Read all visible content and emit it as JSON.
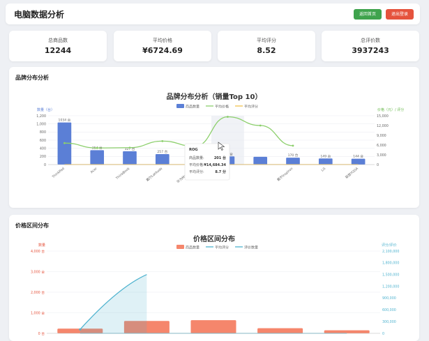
{
  "header": {
    "title": "电脑数据分析",
    "back_label": "返回首页",
    "logout_label": "退出登录"
  },
  "stats": [
    {
      "label": "总商品数",
      "value": "12244"
    },
    {
      "label": "平均价格",
      "value": "¥6724.69"
    },
    {
      "label": "平均评分",
      "value": "8.52"
    },
    {
      "label": "总评价数",
      "value": "3937243"
    }
  ],
  "brand_section": {
    "title": "品牌分布分析"
  },
  "price_section": {
    "title": "价格区间分布"
  },
  "colors": {
    "bar_blue": "#5b7fd6",
    "line_green": "#8ccf6c",
    "line_yellow": "#f2c14e",
    "bar_salmon": "#f5866c",
    "line_cyan": "#4fb3cf",
    "green_btn": "#3fa34d",
    "red_btn": "#e5533d"
  },
  "chart_data": [
    {
      "type": "bar",
      "title": "品牌分布分析（销量Top 10）",
      "categories": [
        "ThinkPad",
        "Acer",
        "ThinkBook",
        "戴尔Latitude",
        "华为MateBook",
        "ROG",
        "",
        "戴尔Inspiron",
        "LG",
        "联想YOGA"
      ],
      "bar_labels": [
        "1034 台",
        "354 台",
        "327 台",
        "257 台",
        "205 台",
        "201 台",
        "",
        "170 台",
        "149 台",
        "144 台"
      ],
      "series": [
        {
          "name": "商品数量",
          "values": [
            1034,
            354,
            327,
            257,
            205,
            201,
            190,
            170,
            149,
            144
          ]
        },
        {
          "name": "平均价格",
          "values": [
            6600,
            5100,
            5200,
            7200,
            5600,
            14684.34,
            12000,
            5800,
            0,
            0
          ]
        },
        {
          "name": "平均评分",
          "values": [
            8.6,
            8.5,
            8.4,
            8.6,
            8.5,
            8.7,
            8.6,
            8.5,
            8.4,
            8.5
          ]
        }
      ],
      "ylabel": "数量（台）",
      "ylabel2": "价格（元）/ 评分",
      "ylim": [
        0,
        1200
      ],
      "yticks": [
        "0",
        "200",
        "400",
        "600",
        "800",
        "1,000",
        "1,200"
      ],
      "ylim2": [
        0,
        15000
      ],
      "yticks2": [
        "0",
        "3,000",
        "6,000",
        "9,000",
        "12,000",
        "15,000"
      ],
      "legend": "top-center",
      "tooltip": {
        "title": "ROG",
        "rows": [
          {
            "label": "商品数量:",
            "value": "201 台"
          },
          {
            "label": "平均价格:",
            "value": "¥14,684.34"
          },
          {
            "label": "平均评分:",
            "value": "8.7 分"
          }
        ]
      }
    },
    {
      "type": "bar",
      "title": "价格区间分布",
      "categories": [
        "",
        "",
        "",
        "",
        ""
      ],
      "series": [
        {
          "name": "商品数量",
          "values": [
            230,
            600,
            640,
            250,
            150
          ]
        },
        {
          "name": "平均评分",
          "values": [
            0,
            0,
            0,
            0,
            0
          ]
        },
        {
          "name": "评价数量",
          "values": [
            100000,
            1500000
          ]
        }
      ],
      "ylabel": "数量",
      "ylabel2": "评分/评价",
      "ylim": [
        0,
        4000
      ],
      "yticks": [
        "0 台",
        "1,000 台",
        "2,000 台",
        "3,000 台",
        "4,000 台"
      ],
      "ylim2": [
        0,
        2100000
      ],
      "yticks2": [
        "0",
        "300,000",
        "600,000",
        "900,000",
        "1,200,000",
        "1,500,000",
        "1,800,000",
        "2,100,000"
      ],
      "legend": "top-center"
    }
  ]
}
